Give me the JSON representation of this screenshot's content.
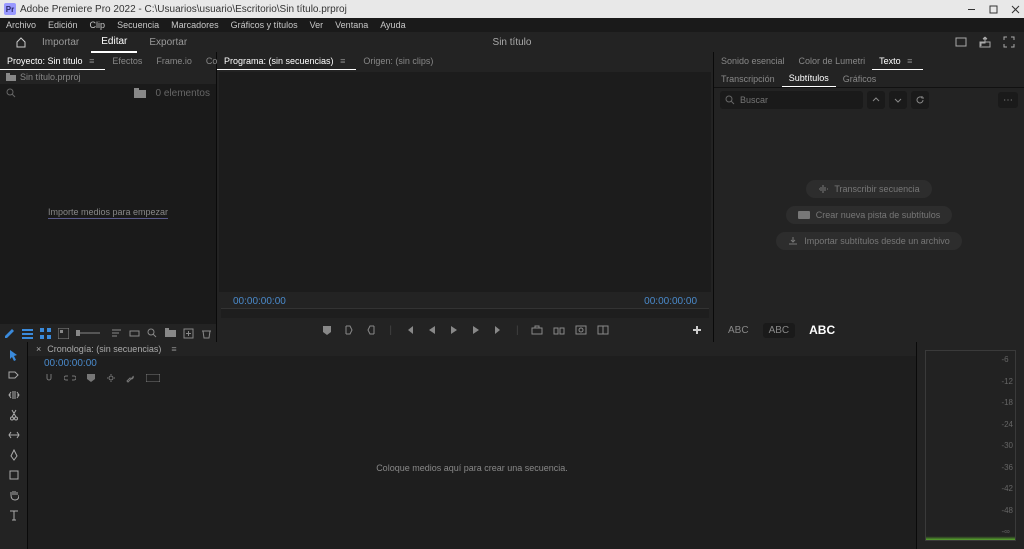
{
  "titlebar": {
    "app": "Adobe Premiere Pro 2022",
    "path": "C:\\Usuarios\\usuario\\Escritorio\\Sin título.prproj"
  },
  "menu": {
    "archivo": "Archivo",
    "edicion": "Edición",
    "clip": "Clip",
    "secuencia": "Secuencia",
    "marcadores": "Marcadores",
    "graficos": "Gráficos y títulos",
    "ver": "Ver",
    "ventana": "Ventana",
    "ayuda": "Ayuda"
  },
  "workspace": {
    "importar": "Importar",
    "editar": "Editar",
    "exportar": "Exportar",
    "title": "Sin título"
  },
  "project": {
    "tab_proyecto": "Proyecto: Sin título",
    "tab_efectos": "Efectos",
    "tab_frameio": "Frame.io",
    "tab_controles": "Controles de",
    "file": "Sin título.prproj",
    "count": "0 elementos",
    "drop_hint": "Importe medios para empezar"
  },
  "program": {
    "tab_programa": "Programa: (sin secuencias)",
    "tab_origen": "Origen: (sin clips)",
    "tc_left": "00:00:00:00",
    "tc_right": "00:00:00:00"
  },
  "text": {
    "tab_sonido": "Sonido esencial",
    "tab_lumetri": "Color de Lumetri",
    "tab_texto": "Texto",
    "sub_transcripcion": "Transcripción",
    "sub_subtitulos": "Subtítulos",
    "sub_graficos": "Gráficos",
    "search_ph": "Buscar",
    "btn_transcribir": "Transcribir secuencia",
    "btn_crear": "Crear nueva pista de subtítulos",
    "btn_importar": "Importar subtítulos desde un archivo",
    "abc_small1": "ABC",
    "abc_small2": "ABC",
    "abc_big": "ABC"
  },
  "timeline": {
    "tab": "Cronología: (sin secuencias)",
    "tc": "00:00:00:00",
    "drop_hint": "Coloque medios aquí para crear una secuencia."
  },
  "audio": {
    "ticks": [
      "-6",
      "-12",
      "-18",
      "-24",
      "-30",
      "-36",
      "-42",
      "-48",
      "-∞"
    ]
  }
}
